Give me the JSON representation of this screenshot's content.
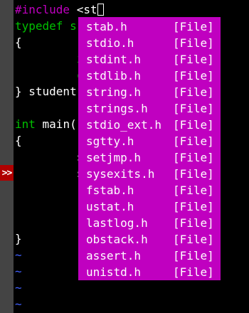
{
  "colors": {
    "background": "#000000",
    "gutter": "#444444",
    "sign": "#b00000",
    "preproc": "#c000c0",
    "type": "#00c000",
    "text": "#ffffff",
    "tilde": "#4060ff",
    "popup_bg": "#c000c0",
    "popup_text": "#ffffff"
  },
  "gutter": {
    "sign_text": ">>",
    "sign_line": 10
  },
  "code_lines": [
    [
      {
        "t": "#include ",
        "c": "preproc"
      },
      {
        "t": "<st",
        "c": "text"
      },
      {
        "t": "",
        "c": "cursor"
      }
    ],
    [
      {
        "t": "typedef s",
        "c": "type"
      }
    ],
    [
      {
        "t": "{",
        "c": "text"
      }
    ],
    [
      {
        "t": "         i",
        "c": "type"
      }
    ],
    [
      {
        "t": "         c",
        "c": "type"
      }
    ],
    [
      {
        "t": "} student",
        "c": "text"
      }
    ],
    [
      {
        "t": "",
        "c": "text"
      }
    ],
    [
      {
        "t": "int",
        "c": "type"
      },
      {
        "t": " main(",
        "c": "text"
      }
    ],
    [
      {
        "t": "{",
        "c": "text"
      }
    ],
    [
      {
        "t": "         s",
        "c": "text"
      }
    ],
    [
      {
        "t": "         s",
        "c": "text"
      }
    ],
    [
      {
        "t": "",
        "c": "text"
      }
    ],
    [
      {
        "t": "",
        "c": "text"
      }
    ],
    [
      {
        "t": "         r",
        "c": "type"
      }
    ],
    [
      {
        "t": "}",
        "c": "text"
      }
    ],
    [
      {
        "t": "~",
        "c": "tilde"
      }
    ],
    [
      {
        "t": "~",
        "c": "tilde"
      }
    ],
    [
      {
        "t": "~",
        "c": "tilde"
      }
    ],
    [
      {
        "t": "~",
        "c": "tilde"
      }
    ]
  ],
  "completion_menu": {
    "items": [
      {
        "name": "stab.h",
        "kind": "[File]"
      },
      {
        "name": "stdio.h",
        "kind": "[File]"
      },
      {
        "name": "stdint.h",
        "kind": "[File]"
      },
      {
        "name": "stdlib.h",
        "kind": "[File]"
      },
      {
        "name": "string.h",
        "kind": "[File]"
      },
      {
        "name": "strings.h",
        "kind": "[File]"
      },
      {
        "name": "stdio_ext.h",
        "kind": "[File]"
      },
      {
        "name": "sgtty.h",
        "kind": "[File]"
      },
      {
        "name": "setjmp.h",
        "kind": "[File]"
      },
      {
        "name": "sysexits.h",
        "kind": "[File]"
      },
      {
        "name": "fstab.h",
        "kind": "[File]"
      },
      {
        "name": "ustat.h",
        "kind": "[File]"
      },
      {
        "name": "lastlog.h",
        "kind": "[File]"
      },
      {
        "name": "obstack.h",
        "kind": "[File]"
      },
      {
        "name": "assert.h",
        "kind": "[File]"
      },
      {
        "name": "unistd.h",
        "kind": "[File]"
      }
    ]
  }
}
